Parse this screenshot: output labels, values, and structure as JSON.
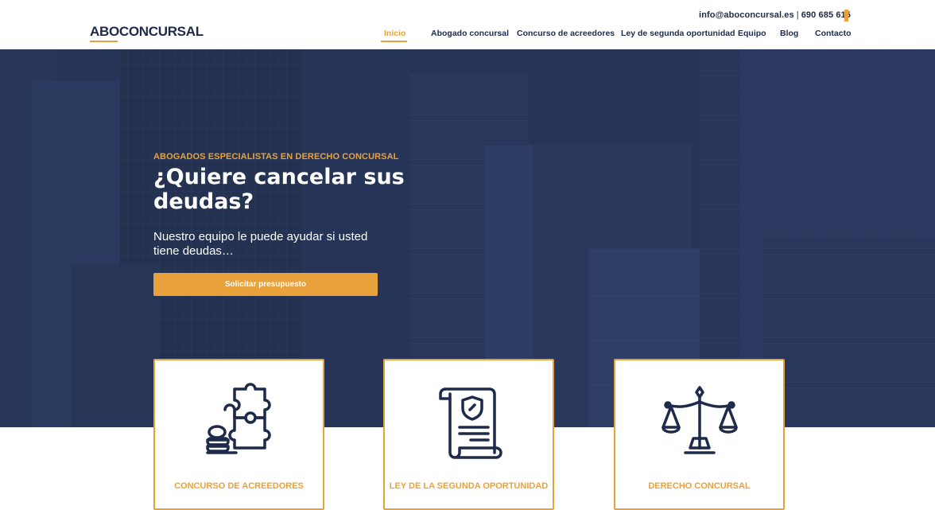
{
  "header": {
    "logo": "ABOCONCURSAL",
    "email": "info@aboconcursal.es",
    "separator": "|",
    "phone": "690 685 615"
  },
  "nav": {
    "items": [
      {
        "label": "Inicio",
        "active": true
      },
      {
        "label": "Abogado concursal"
      },
      {
        "label": "Concurso de acreedores"
      },
      {
        "label": "Ley de segunda oportunidad"
      },
      {
        "label": "Equipo"
      },
      {
        "label": "Blog"
      },
      {
        "label": "Contacto"
      }
    ]
  },
  "hero": {
    "kicker": "ABOGADOS ESPECIALISTAS EN DERECHO CONCURSAL",
    "headline": "¿Quiere cancelar sus deudas?",
    "subtitle": "Nuestro equipo le puede ayudar si usted tiene deudas…",
    "cta_label": "Solicitar presupuesto"
  },
  "cards": [
    {
      "title": "CONCURSO DE ACREEDORES",
      "icon": "puzzle-coins-icon"
    },
    {
      "title": "LEY DE LA SEGUNDA OPORTUNIDAD",
      "icon": "document-shield-icon"
    },
    {
      "title": "DERECHO CONCURSAL",
      "icon": "scales-icon"
    }
  ],
  "colors": {
    "accent": "#e9a23b",
    "navy": "#1e2a4a",
    "hero_overlay": "#233052"
  }
}
